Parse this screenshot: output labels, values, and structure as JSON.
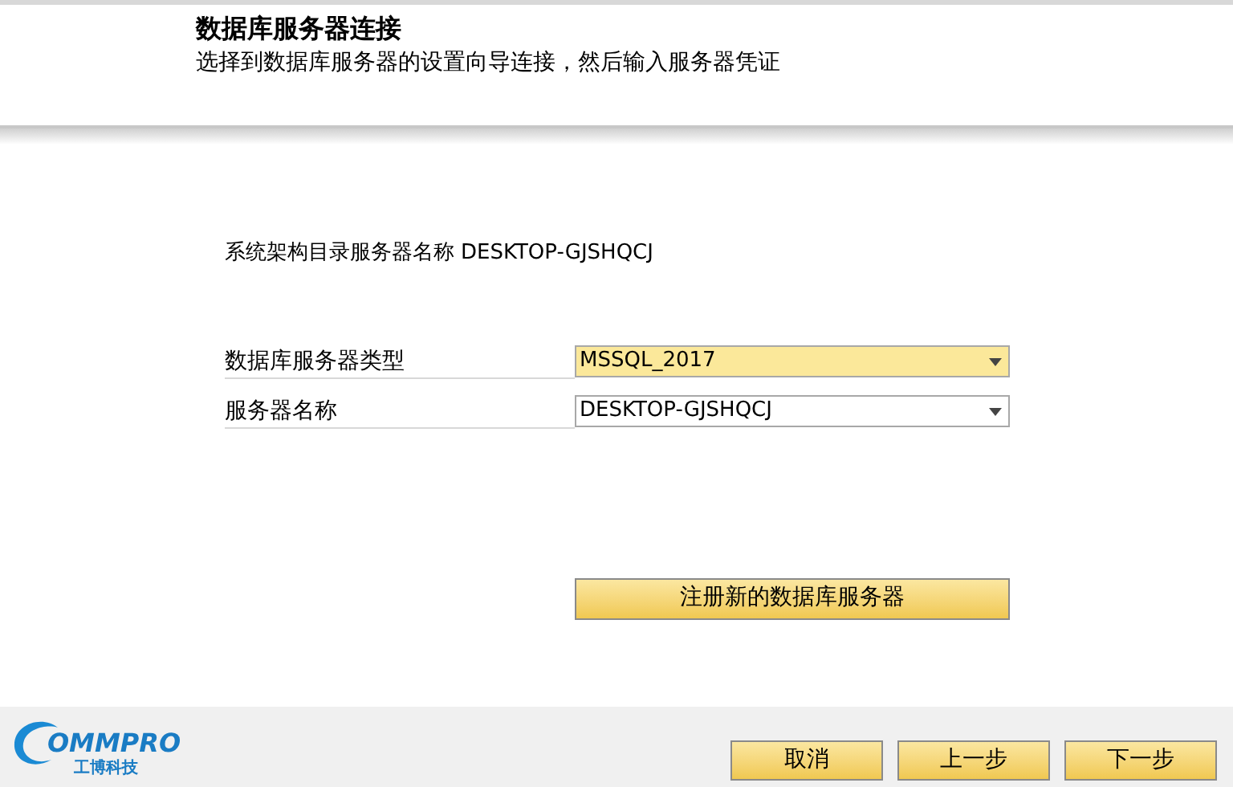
{
  "header": {
    "title": "数据库服务器连接",
    "subtitle": "选择到数据库服务器的设置向导连接，然后输入服务器凭证"
  },
  "catalog": {
    "label": "系统架构目录服务器名称",
    "value": "DESKTOP-GJSHQCJ"
  },
  "fields": [
    {
      "label": "数据库服务器类型",
      "value": "MSSQL_2017",
      "focused": true
    },
    {
      "label": "服务器名称",
      "value": "DESKTOP-GJSHQCJ",
      "focused": false
    }
  ],
  "register_button": "注册新的数据库服务器",
  "logo": {
    "wordmark": "OMMPRO",
    "tagline": "工博科技"
  },
  "buttons": [
    "取消",
    "上一步",
    "下一步"
  ]
}
